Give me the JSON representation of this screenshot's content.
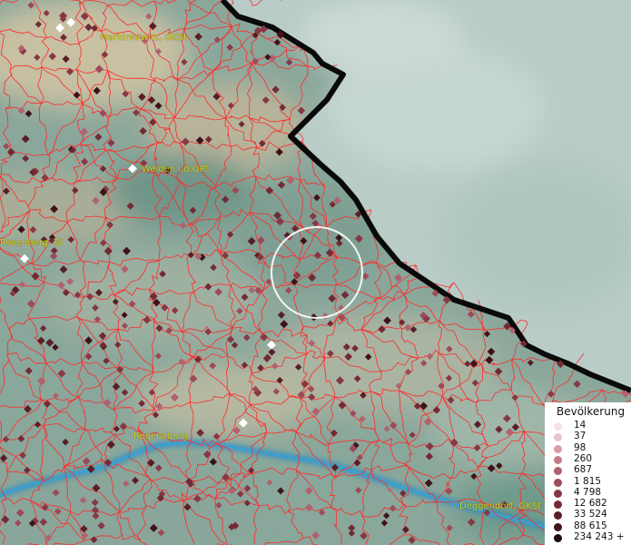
{
  "map": {
    "labels": {
      "marktredwitz": "Marktredwitz, GKSt",
      "weiden": "Weiden i.d.OPf.",
      "rosenberg": "Rosenberg, St",
      "regensburg": "Regensburg",
      "deggendorf": "Deggendorf, GKSt"
    },
    "colors": {
      "border": "#ff2a2a",
      "country_border": "#0a0a0a",
      "river": "#2f8fbf",
      "city_marker": "#ffffff",
      "label": "#d9d21a"
    }
  },
  "legend": {
    "title": "Bevölkerung",
    "items": [
      {
        "label": "14",
        "color": "#f7dfe6"
      },
      {
        "label": "37",
        "color": "#ecc4ce"
      },
      {
        "label": "98",
        "color": "#d99ba8"
      },
      {
        "label": "260",
        "color": "#c57d8a"
      },
      {
        "label": "687",
        "color": "#b0626f"
      },
      {
        "label": "1 815",
        "color": "#9c4b58"
      },
      {
        "label": "4 798",
        "color": "#873844"
      },
      {
        "label": "12 682",
        "color": "#722a34"
      },
      {
        "label": "33 524",
        "color": "#591e26"
      },
      {
        "label": "88 615",
        "color": "#3f1319"
      },
      {
        "label": "234 243 +",
        "color": "#20090c"
      }
    ]
  }
}
